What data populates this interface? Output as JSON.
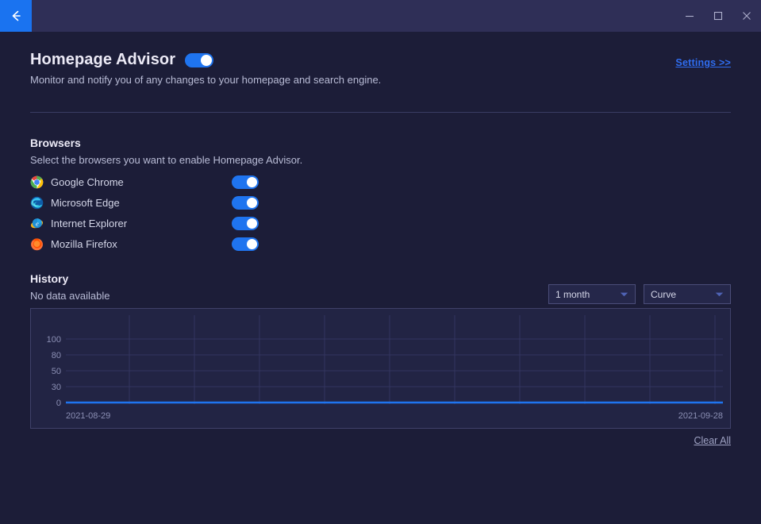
{
  "titlebar": {
    "back_icon": "arrow-left-icon",
    "minimize_label": "minimize-icon",
    "maximize_label": "maximize-icon",
    "close_label": "close-icon"
  },
  "header": {
    "title": "Homepage Advisor",
    "enabled": true,
    "subtitle": "Monitor and notify you of any changes to your homepage and search engine.",
    "settings_link": "Settings >>"
  },
  "browsers": {
    "heading": "Browsers",
    "subheading": "Select the browsers you want to enable Homepage Advisor.",
    "items": [
      {
        "name": "Google Chrome",
        "icon": "chrome-icon",
        "enabled": true
      },
      {
        "name": "Microsoft Edge",
        "icon": "edge-icon",
        "enabled": true
      },
      {
        "name": "Internet Explorer",
        "icon": "ie-icon",
        "enabled": true
      },
      {
        "name": "Mozilla Firefox",
        "icon": "firefox-icon",
        "enabled": true
      }
    ]
  },
  "history": {
    "heading": "History",
    "status": "No data available",
    "range_select": "1 month",
    "style_select": "Curve",
    "clear_all": "Clear All"
  },
  "chart_data": {
    "type": "line",
    "title": "",
    "xlabel": "",
    "ylabel": "",
    "x_tick_labels": [
      "2021-08-29",
      "2021-09-28"
    ],
    "y_tick_labels": [
      "100",
      "80",
      "50",
      "30",
      "0"
    ],
    "y_tick_values": [
      100,
      80,
      50,
      30,
      0
    ],
    "ylim": [
      0,
      115
    ],
    "grid": true,
    "legend": "none",
    "series": [
      {
        "name": "history",
        "color": "#1f74ef",
        "x": [
          "2021-08-29",
          "2021-09-28"
        ],
        "values": [
          0,
          0
        ]
      }
    ]
  },
  "colors": {
    "accent": "#1f74ef",
    "link": "#2f6df0",
    "titlebar_bg": "#2f2f57",
    "body_bg": "#1c1d38",
    "panel_bg": "#222444",
    "panel_border": "#3f4169",
    "text_primary": "#eceaf6",
    "text_secondary": "#b9bcd6"
  }
}
